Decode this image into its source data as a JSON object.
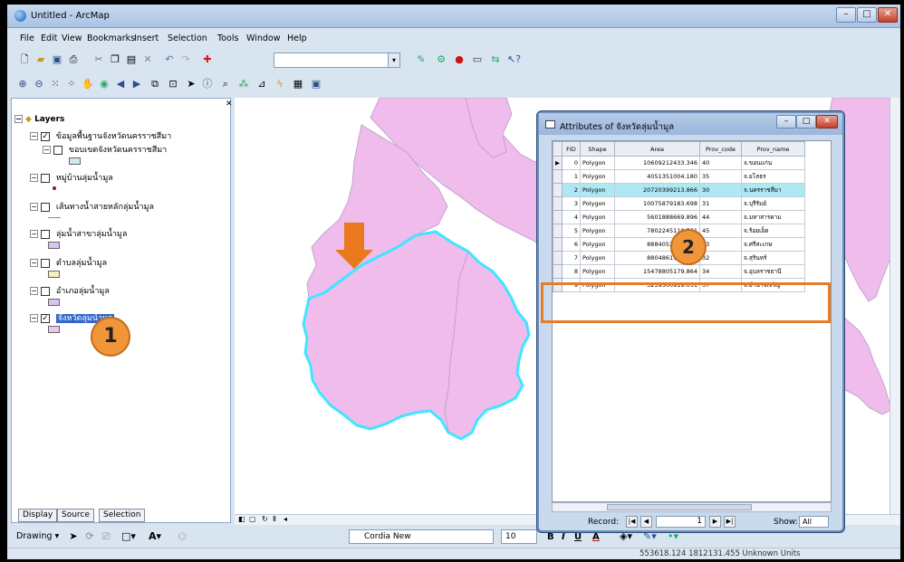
{
  "window": {
    "title": "Untitled - ArcMap",
    "minimize": "–",
    "restore": "□",
    "close": "✕"
  },
  "menu": [
    "File",
    "Edit",
    "View",
    "Bookmarks",
    "Insert",
    "Selection",
    "Tools",
    "Window",
    "Help"
  ],
  "toc": {
    "root_label": "Layers",
    "layers": [
      {
        "label": "ข้อมูลพื้นฐานจังหวัดนครราชสีมา",
        "checked": true
      },
      {
        "label": "ขอบเขตจังหวัดนครราชสีมา",
        "checked": false
      },
      {
        "label": "หมู่บ้านลุ่มน้ำมูล",
        "checked": false
      },
      {
        "label": "เส้นทางน้ำสายหลักลุ่มน้ำมูล",
        "checked": false
      },
      {
        "label": "ลุ่มน้ำสาขาลุ่มน้ำมูล",
        "checked": false
      },
      {
        "label": "ตำบลลุ่มน้ำมูล",
        "checked": false
      },
      {
        "label": "อำเภอลุ่มน้ำมูล",
        "checked": false
      },
      {
        "label": "จังหวัดลุ่มน้ำมูล",
        "checked": true
      }
    ],
    "tabs": [
      "Display",
      "Source",
      "Selection"
    ],
    "swatch_colors": {
      "blue": "#cde8f0",
      "purple": "#d7c4ef",
      "yellow": "#f3f0b8",
      "pink": "#f0c4ee"
    }
  },
  "callouts": {
    "one": "1",
    "two": "2"
  },
  "map": {
    "polygon_fill": "#efbcec",
    "selection_outline": "#3fe6ff"
  },
  "attributes": {
    "title": "Attributes of จังหวัดลุ่มน้ำมูล",
    "columns": [
      "FID",
      "Shape",
      "Area",
      "Prov_code",
      "Prov_name"
    ],
    "rows": [
      {
        "fid": "0",
        "shape": "Polygon",
        "area": "10609212433.346",
        "code": "40",
        "name": "จ.ขอนแก่น",
        "selected": false
      },
      {
        "fid": "1",
        "shape": "Polygon",
        "area": "4051351004.180",
        "code": "35",
        "name": "จ.ยโสธร",
        "selected": false
      },
      {
        "fid": "2",
        "shape": "Polygon",
        "area": "20720399213.866",
        "code": "30",
        "name": "จ.นครราชสีมา",
        "selected": true
      },
      {
        "fid": "3",
        "shape": "Polygon",
        "area": "10075879183.698",
        "code": "31",
        "name": "จ.บุรีรัมย์",
        "selected": false
      },
      {
        "fid": "4",
        "shape": "Polygon",
        "area": "5601888669.896",
        "code": "44",
        "name": "จ.มหาสารคาม",
        "selected": false
      },
      {
        "fid": "5",
        "shape": "Polygon",
        "area": "7802245110.561",
        "code": "45",
        "name": "จ.ร้อยเอ็ด",
        "selected": false
      },
      {
        "fid": "6",
        "shape": "Polygon",
        "area": "8884052114.211",
        "code": "33",
        "name": "จ.ศรีสะเกษ",
        "selected": false
      },
      {
        "fid": "7",
        "shape": "Polygon",
        "area": "8804861152.120",
        "code": "32",
        "name": "จ.สุรินทร์",
        "selected": false
      },
      {
        "fid": "8",
        "shape": "Polygon",
        "area": "15478805179.864",
        "code": "34",
        "name": "จ.อุบลราชธานี",
        "selected": false
      },
      {
        "fid": "9",
        "shape": "Polygon",
        "area": "3239500919.051",
        "code": "37",
        "name": "จ.อำนาจเจริญ",
        "selected": false
      }
    ],
    "record_label": "Record:",
    "record_value": "1",
    "show_label": "Show:",
    "show_value": "All"
  },
  "drawbar": {
    "drawing_label": "Drawing ▾",
    "font_name": "Cordia New",
    "font_size": "10",
    "bold": "B",
    "italic": "I",
    "underline": "U",
    "font_color": "A"
  },
  "status": {
    "coords": "553618.124  1812131.455 Unknown Units"
  }
}
